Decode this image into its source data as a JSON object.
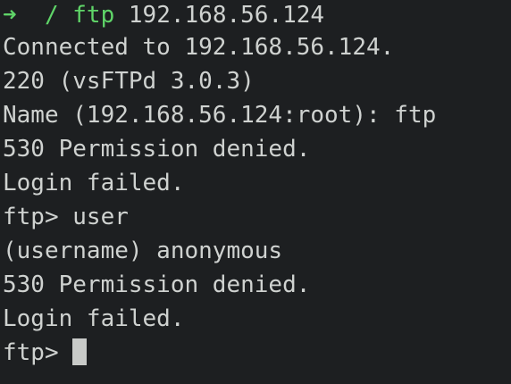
{
  "prompt": {
    "arrow": "➜",
    "cwd": "/",
    "command": "ftp",
    "argument": "192.168.56.124"
  },
  "output_lines": [
    "Connected to 192.168.56.124.",
    "220 (vsFTPd 3.0.3)",
    "Name (192.168.56.124:root): ftp",
    "530 Permission denied.",
    "Login failed.",
    "ftp> user",
    "(username) anonymous",
    "530 Permission denied.",
    "Login failed."
  ],
  "input_prompt": "ftp> ",
  "colors": {
    "background": "#1d1f21",
    "foreground": "#cfd2d0",
    "prompt_green": "#5fd468",
    "cursor": "#c8cac8"
  }
}
